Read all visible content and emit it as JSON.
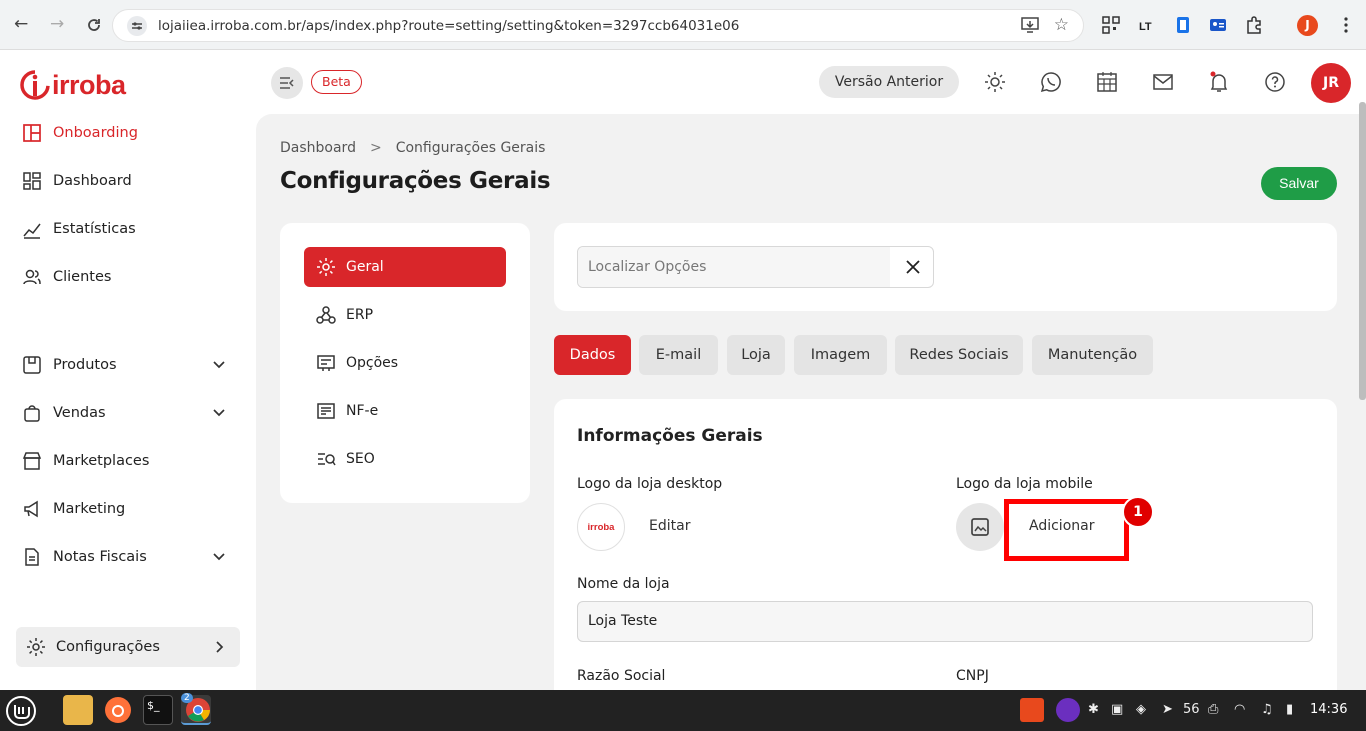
{
  "browser": {
    "url": "lojaiiea.irroba.com.br/aps/index.php?route=setting/setting&token=3297ccb64031e06",
    "profile_initial": "J"
  },
  "brand": {
    "name": "irroba",
    "color": "#d9262a"
  },
  "sidebar": {
    "items": [
      {
        "label": "Onboarding",
        "icon": "layout-icon",
        "active": true
      },
      {
        "label": "Dashboard",
        "icon": "grid-icon"
      },
      {
        "label": "Estatísticas",
        "icon": "stats-icon"
      },
      {
        "label": "Clientes",
        "icon": "users-icon"
      },
      {
        "label": "Produtos",
        "icon": "box-icon",
        "expandable": true
      },
      {
        "label": "Vendas",
        "icon": "bag-icon",
        "expandable": true
      },
      {
        "label": "Marketplaces",
        "icon": "store-icon"
      },
      {
        "label": "Marketing",
        "icon": "megaphone-icon"
      },
      {
        "label": "Notas Fiscais",
        "icon": "document-icon",
        "expandable": true
      },
      {
        "label": "Configurações",
        "icon": "gear-icon"
      }
    ]
  },
  "topbar": {
    "beta": "Beta",
    "previous_version": "Versão Anterior",
    "avatar": "JR"
  },
  "page": {
    "breadcrumb": [
      "Dashboard",
      "Configurações Gerais"
    ],
    "breadcrumb_sep": ">",
    "title": "Configurações Gerais",
    "save": "Salvar"
  },
  "settings_menu": [
    {
      "label": "Geral",
      "active": true
    },
    {
      "label": "ERP"
    },
    {
      "label": "Opções"
    },
    {
      "label": "NF-e"
    },
    {
      "label": "SEO"
    }
  ],
  "search": {
    "placeholder": "Localizar Opções"
  },
  "tabs": [
    {
      "label": "Dados",
      "active": true
    },
    {
      "label": "E-mail"
    },
    {
      "label": "Loja"
    },
    {
      "label": "Imagem"
    },
    {
      "label": "Redes Sociais"
    },
    {
      "label": "Manutenção"
    }
  ],
  "info": {
    "title": "Informações Gerais",
    "logo_desktop_label": "Logo da loja desktop",
    "logo_desktop_action": "Editar",
    "logo_mobile_label": "Logo da loja mobile",
    "logo_mobile_action": "Adicionar",
    "store_name_label": "Nome da loja",
    "store_name_value": "Loja Teste",
    "razao_label": "Razão Social",
    "cnpj_label": "CNPJ"
  },
  "annotation": {
    "number": "1",
    "color": "#ff0000"
  },
  "taskbar": {
    "chrome_badge": "2",
    "tray_number": "56",
    "clock": "14:36"
  }
}
